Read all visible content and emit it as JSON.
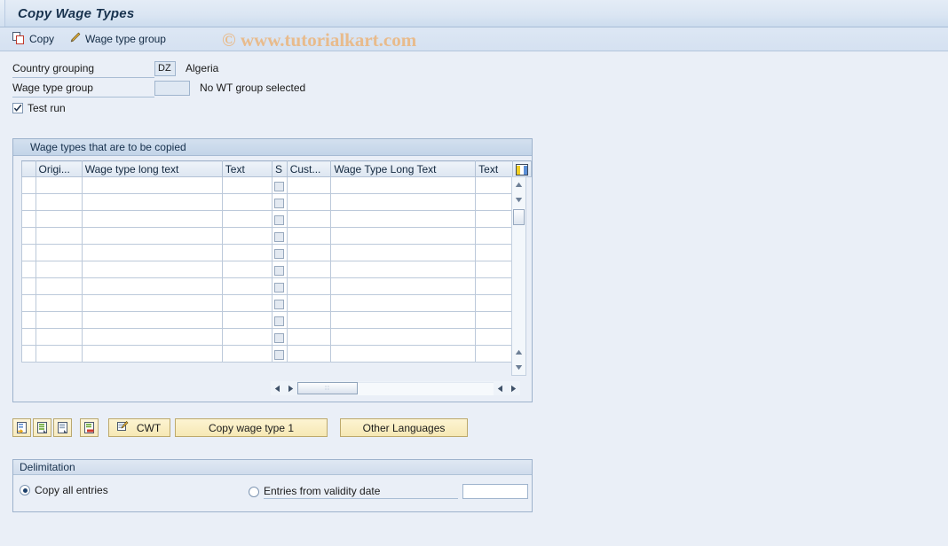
{
  "window": {
    "title": "Copy Wage Types"
  },
  "toolbar": {
    "buttons": [
      {
        "label": "Copy",
        "icon": "copy-icon"
      },
      {
        "label": "Wage type group",
        "icon": "pencil-icon"
      }
    ],
    "watermark": "© www.tutorialkart.com"
  },
  "form": {
    "country_grouping": {
      "label": "Country grouping",
      "value": "DZ",
      "description": "Algeria"
    },
    "wage_type_group": {
      "label": "Wage type group",
      "value": "",
      "description": "No WT group selected"
    },
    "test_run": {
      "label": "Test run",
      "checked": true
    }
  },
  "table": {
    "caption": "Wage types that are to be copied",
    "columns": [
      {
        "key": "selector",
        "label": ""
      },
      {
        "key": "origin",
        "label": "Origi..."
      },
      {
        "key": "wage_type_long_text",
        "label": "Wage type long text"
      },
      {
        "key": "text1",
        "label": "Text"
      },
      {
        "key": "s",
        "label": "S"
      },
      {
        "key": "cust",
        "label": "Cust..."
      },
      {
        "key": "wage_type_long_text_2",
        "label": "Wage Type Long Text"
      },
      {
        "key": "text2",
        "label": "Text"
      },
      {
        "key": "config",
        "label": "",
        "icon": "table-settings-icon"
      }
    ],
    "rows": [
      {
        "origin": "",
        "wage_type_long_text": "",
        "text1": "",
        "s": false,
        "cust": "",
        "wage_type_long_text_2": "",
        "text2": ""
      },
      {
        "origin": "",
        "wage_type_long_text": "",
        "text1": "",
        "s": false,
        "cust": "",
        "wage_type_long_text_2": "",
        "text2": ""
      },
      {
        "origin": "",
        "wage_type_long_text": "",
        "text1": "",
        "s": false,
        "cust": "",
        "wage_type_long_text_2": "",
        "text2": ""
      },
      {
        "origin": "",
        "wage_type_long_text": "",
        "text1": "",
        "s": false,
        "cust": "",
        "wage_type_long_text_2": "",
        "text2": ""
      },
      {
        "origin": "",
        "wage_type_long_text": "",
        "text1": "",
        "s": false,
        "cust": "",
        "wage_type_long_text_2": "",
        "text2": ""
      },
      {
        "origin": "",
        "wage_type_long_text": "",
        "text1": "",
        "s": false,
        "cust": "",
        "wage_type_long_text_2": "",
        "text2": ""
      },
      {
        "origin": "",
        "wage_type_long_text": "",
        "text1": "",
        "s": false,
        "cust": "",
        "wage_type_long_text_2": "",
        "text2": ""
      },
      {
        "origin": "",
        "wage_type_long_text": "",
        "text1": "",
        "s": false,
        "cust": "",
        "wage_type_long_text_2": "",
        "text2": ""
      },
      {
        "origin": "",
        "wage_type_long_text": "",
        "text1": "",
        "s": false,
        "cust": "",
        "wage_type_long_text_2": "",
        "text2": ""
      },
      {
        "origin": "",
        "wage_type_long_text": "",
        "text1": "",
        "s": false,
        "cust": "",
        "wage_type_long_text_2": "",
        "text2": ""
      },
      {
        "origin": "",
        "wage_type_long_text": "",
        "text1": "",
        "s": false,
        "cust": "",
        "wage_type_long_text_2": "",
        "text2": ""
      }
    ],
    "scroll_grip": "∷"
  },
  "actions": {
    "icon_buttons": [
      {
        "name": "insert-row-icon"
      },
      {
        "name": "copy-row-icon"
      },
      {
        "name": "duplicate-row-icon"
      },
      {
        "name": "delete-row-icon"
      }
    ],
    "cwt": {
      "label": "CWT",
      "icon": "cwt-icon"
    },
    "copy_wage_type_1": {
      "label": "Copy wage type 1"
    },
    "other_languages": {
      "label": "Other Languages"
    }
  },
  "delimitation": {
    "caption": "Delimitation",
    "copy_all": {
      "label": "Copy all entries",
      "selected": true
    },
    "from_validity": {
      "label": "Entries from validity date",
      "selected": false,
      "date_value": ""
    }
  },
  "colors": {
    "page_background": "#eaeff7",
    "title_text": "#18324e",
    "watermark": "#e8bb8c",
    "button_face": "#f9efc4",
    "panel_border": "#9db2cc"
  }
}
